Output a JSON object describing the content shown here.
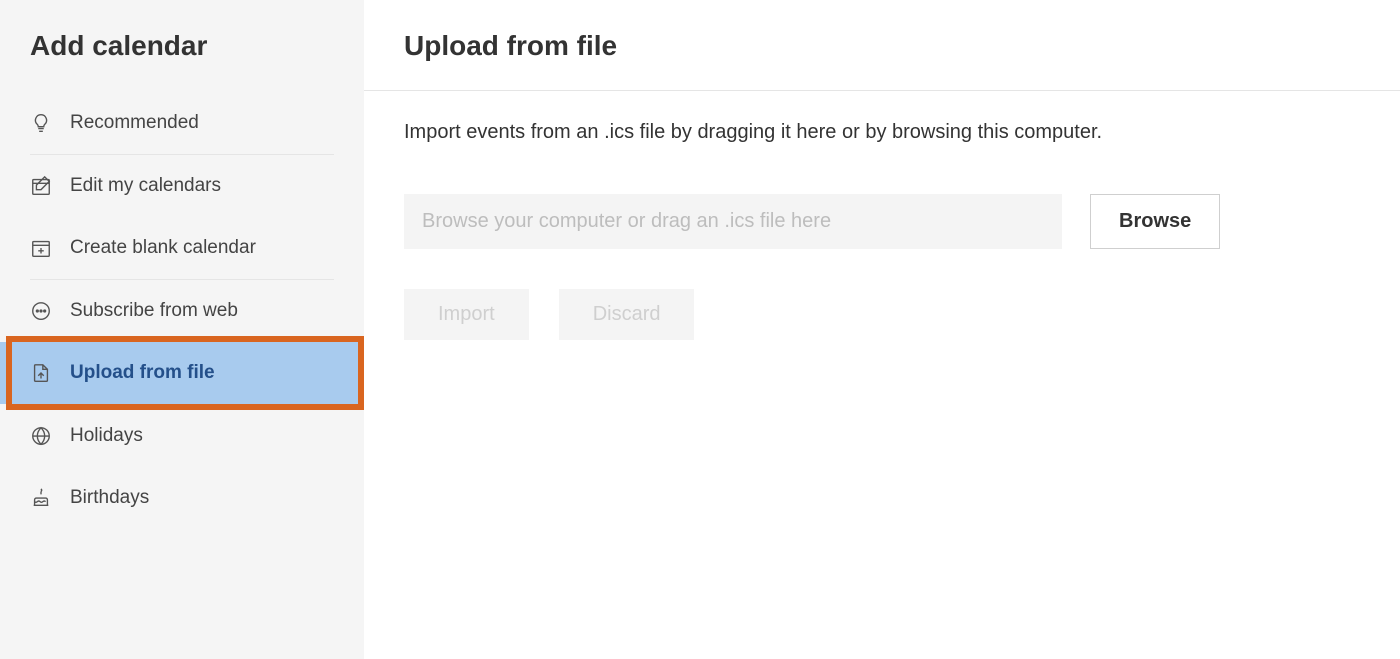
{
  "sidebar": {
    "title": "Add calendar",
    "groups": [
      {
        "items": [
          {
            "icon": "lightbulb",
            "label": "Recommended"
          }
        ]
      },
      {
        "items": [
          {
            "icon": "edit-calendar",
            "label": "Edit my calendars"
          },
          {
            "icon": "blank-calendar",
            "label": "Create blank calendar"
          }
        ]
      },
      {
        "items": [
          {
            "icon": "subscribe",
            "label": "Subscribe from web"
          },
          {
            "icon": "upload-file",
            "label": "Upload from file",
            "selected": true
          }
        ]
      },
      {
        "items": [
          {
            "icon": "globe",
            "label": "Holidays"
          },
          {
            "icon": "cake",
            "label": "Birthdays"
          }
        ]
      }
    ]
  },
  "main": {
    "title": "Upload from file",
    "instruction": "Import events from an .ics file by dragging it here or by browsing this computer.",
    "file_placeholder": "Browse your computer or drag an .ics file here",
    "browse_label": "Browse",
    "import_label": "Import",
    "discard_label": "Discard"
  },
  "annotation": {
    "arrow_color": "#d9651f"
  }
}
